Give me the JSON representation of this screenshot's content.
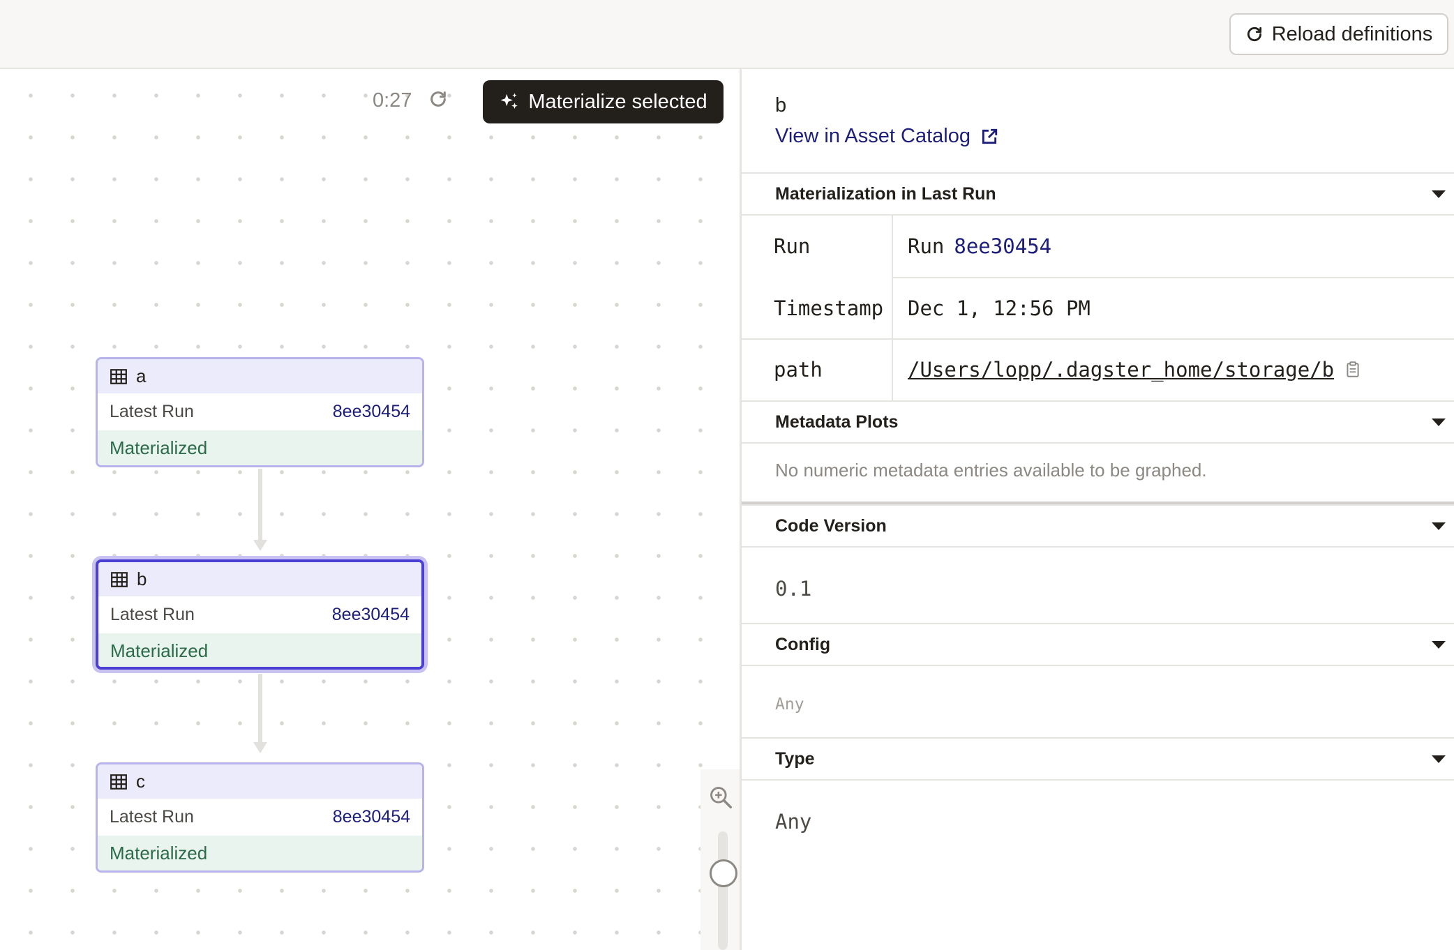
{
  "header": {
    "reload_label": "Reload definitions"
  },
  "canvas_toolbar": {
    "timer": "0:27",
    "materialize_label": "Materialize selected"
  },
  "nodes": [
    {
      "name": "a",
      "latest_run_label": "Latest Run",
      "run_id": "8ee30454",
      "status": "Materialized",
      "selected": false
    },
    {
      "name": "b",
      "latest_run_label": "Latest Run",
      "run_id": "8ee30454",
      "status": "Materialized",
      "selected": true
    },
    {
      "name": "c",
      "latest_run_label": "Latest Run",
      "run_id": "8ee30454",
      "status": "Materialized",
      "selected": false
    }
  ],
  "panel": {
    "asset_name": "b",
    "catalog_link": "View in Asset Catalog",
    "sections": {
      "materialization": {
        "title": "Materialization in Last Run",
        "rows": [
          {
            "key": "Run",
            "value_prefix": "Run",
            "value_link": "8ee30454"
          },
          {
            "key": "Timestamp",
            "value": "Dec 1, 12:56 PM"
          },
          {
            "key": "path",
            "value": "/Users/lopp/.dagster_home/storage/b"
          }
        ]
      },
      "metadata_plots": {
        "title": "Metadata Plots",
        "empty_text": "No numeric metadata entries available to be graphed."
      },
      "code_version": {
        "title": "Code Version",
        "value": "0.1"
      },
      "config": {
        "title": "Config",
        "value": "Any"
      },
      "type": {
        "title": "Type",
        "value": "Any"
      }
    }
  }
}
